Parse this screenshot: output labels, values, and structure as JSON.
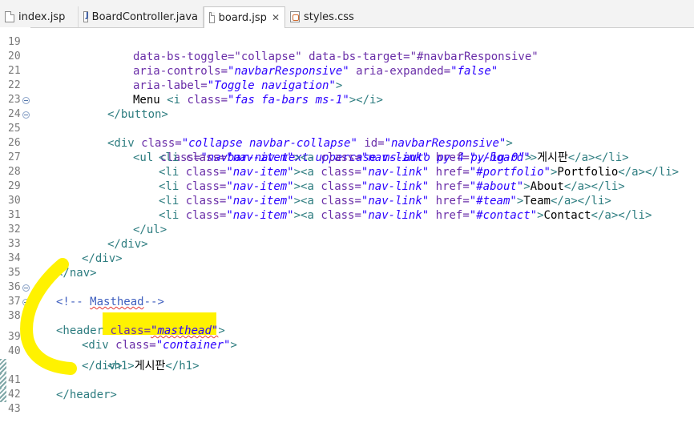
{
  "tabs": [
    {
      "label": "index.jsp",
      "icon": "jsp-file-icon"
    },
    {
      "label": "BoardController.java",
      "icon": "java-file-icon"
    },
    {
      "label": "board.jsp",
      "icon": "jsp-file-icon",
      "active": true,
      "close": "✕"
    },
    {
      "label": "styles.css",
      "icon": "css-file-icon"
    }
  ],
  "lines": {
    "l19": {
      "num": "19",
      "text": "data-bs-toggle=\"collapse\" data-bs-target=\"#navbarResponsive\""
    },
    "l20": {
      "num": "20",
      "attr": "aria-controls=",
      "val": "\"navbarResponsive\"",
      "attr2": " aria-expanded=",
      "val2": "\"false\""
    },
    "l21": {
      "num": "21",
      "attr": "aria-label=",
      "val": "\"Toggle navigation\"",
      "tail": ">"
    },
    "l22": {
      "num": "22",
      "pre": "Menu ",
      "tag": "<i",
      "attr": " class=",
      "val": "\"fas fa-bars ms-1\"",
      "tail": "></i>"
    },
    "l23": {
      "num": "23",
      "tag": "</button>"
    },
    "l24": {
      "num": "24",
      "tag": "<div",
      "attr": " class=",
      "val": "\"collapse navbar-collapse\"",
      "attr2": " id=",
      "val2": "\"navbarResponsive\"",
      "tail": ">"
    },
    "l25": {
      "num": "25",
      "tag": "<ul",
      "attr": " class=",
      "val": "\"navbar-nav text-uppercase ms-auto py-4 py-lg-0\"",
      "tail": ">"
    },
    "l26": {
      "num": "26",
      "li": "<li",
      "cls": " class=",
      "liv": "\"nav-item\"",
      "a": "><a",
      "acls": " class=",
      "av": "\"nav-link\"",
      "href": " href=",
      "hv": "\"./board\"",
      "text": "게시판",
      "close": "</a></li>"
    },
    "l27": {
      "num": "27",
      "li": "<li",
      "cls": " class=",
      "liv": "\"nav-item\"",
      "a": "><a",
      "acls": " class=",
      "av": "\"nav-link\"",
      "href": " href=",
      "hv": "\"#portfolio\"",
      "text": "Portfolio",
      "close": "</a></li>"
    },
    "l28": {
      "num": "28",
      "li": "<li",
      "cls": " class=",
      "liv": "\"nav-item\"",
      "a": "><a",
      "acls": " class=",
      "av": "\"nav-link\"",
      "href": " href=",
      "hv": "\"#about\"",
      "text": "About",
      "close": "</a></li>"
    },
    "l29": {
      "num": "29",
      "li": "<li",
      "cls": " class=",
      "liv": "\"nav-item\"",
      "a": "><a",
      "acls": " class=",
      "av": "\"nav-link\"",
      "href": " href=",
      "hv": "\"#team\"",
      "text": "Team",
      "close": "</a></li>"
    },
    "l30": {
      "num": "30",
      "li": "<li",
      "cls": " class=",
      "liv": "\"nav-item\"",
      "a": "><a",
      "acls": " class=",
      "av": "\"nav-link\"",
      "href": " href=",
      "hv": "\"#contact\"",
      "text": "Contact",
      "close": "</a></li>"
    },
    "l31": {
      "num": "31",
      "tag": "</ul>"
    },
    "l32": {
      "num": "32",
      "tag": "</div>"
    },
    "l33": {
      "num": "33",
      "tag": "</div>"
    },
    "l34": {
      "num": "34",
      "tag": "</nav>"
    },
    "l35": {
      "num": "35"
    },
    "l36": {
      "num": "36",
      "c1": "<!-- ",
      "c2": "Masthead",
      "c3": "-->"
    },
    "l37": {
      "num": "37",
      "tag": "<header",
      "attr": " class=",
      "val": "\"masthead\"",
      "tail": ">"
    },
    "l38": {
      "num": "38",
      "tag": "<div",
      "attr": " class=",
      "val": "\"container\"",
      "tail": ">"
    },
    "l39": {
      "num": "39",
      "tag": "<h1>",
      "text": "게시판",
      "tag2": "</h1>"
    },
    "l40": {
      "num": "40",
      "tag": "</div>"
    },
    "l41": {
      "num": "41",
      "tag": "</header>"
    },
    "l42": {
      "num": "42"
    },
    "l43": {
      "num": "43"
    }
  },
  "colors": {
    "tag": "#2e7d80",
    "attr": "#6a2ea8",
    "value": "#2a00ff",
    "comment": "#3f5fbf",
    "highlight": "#fff200"
  }
}
